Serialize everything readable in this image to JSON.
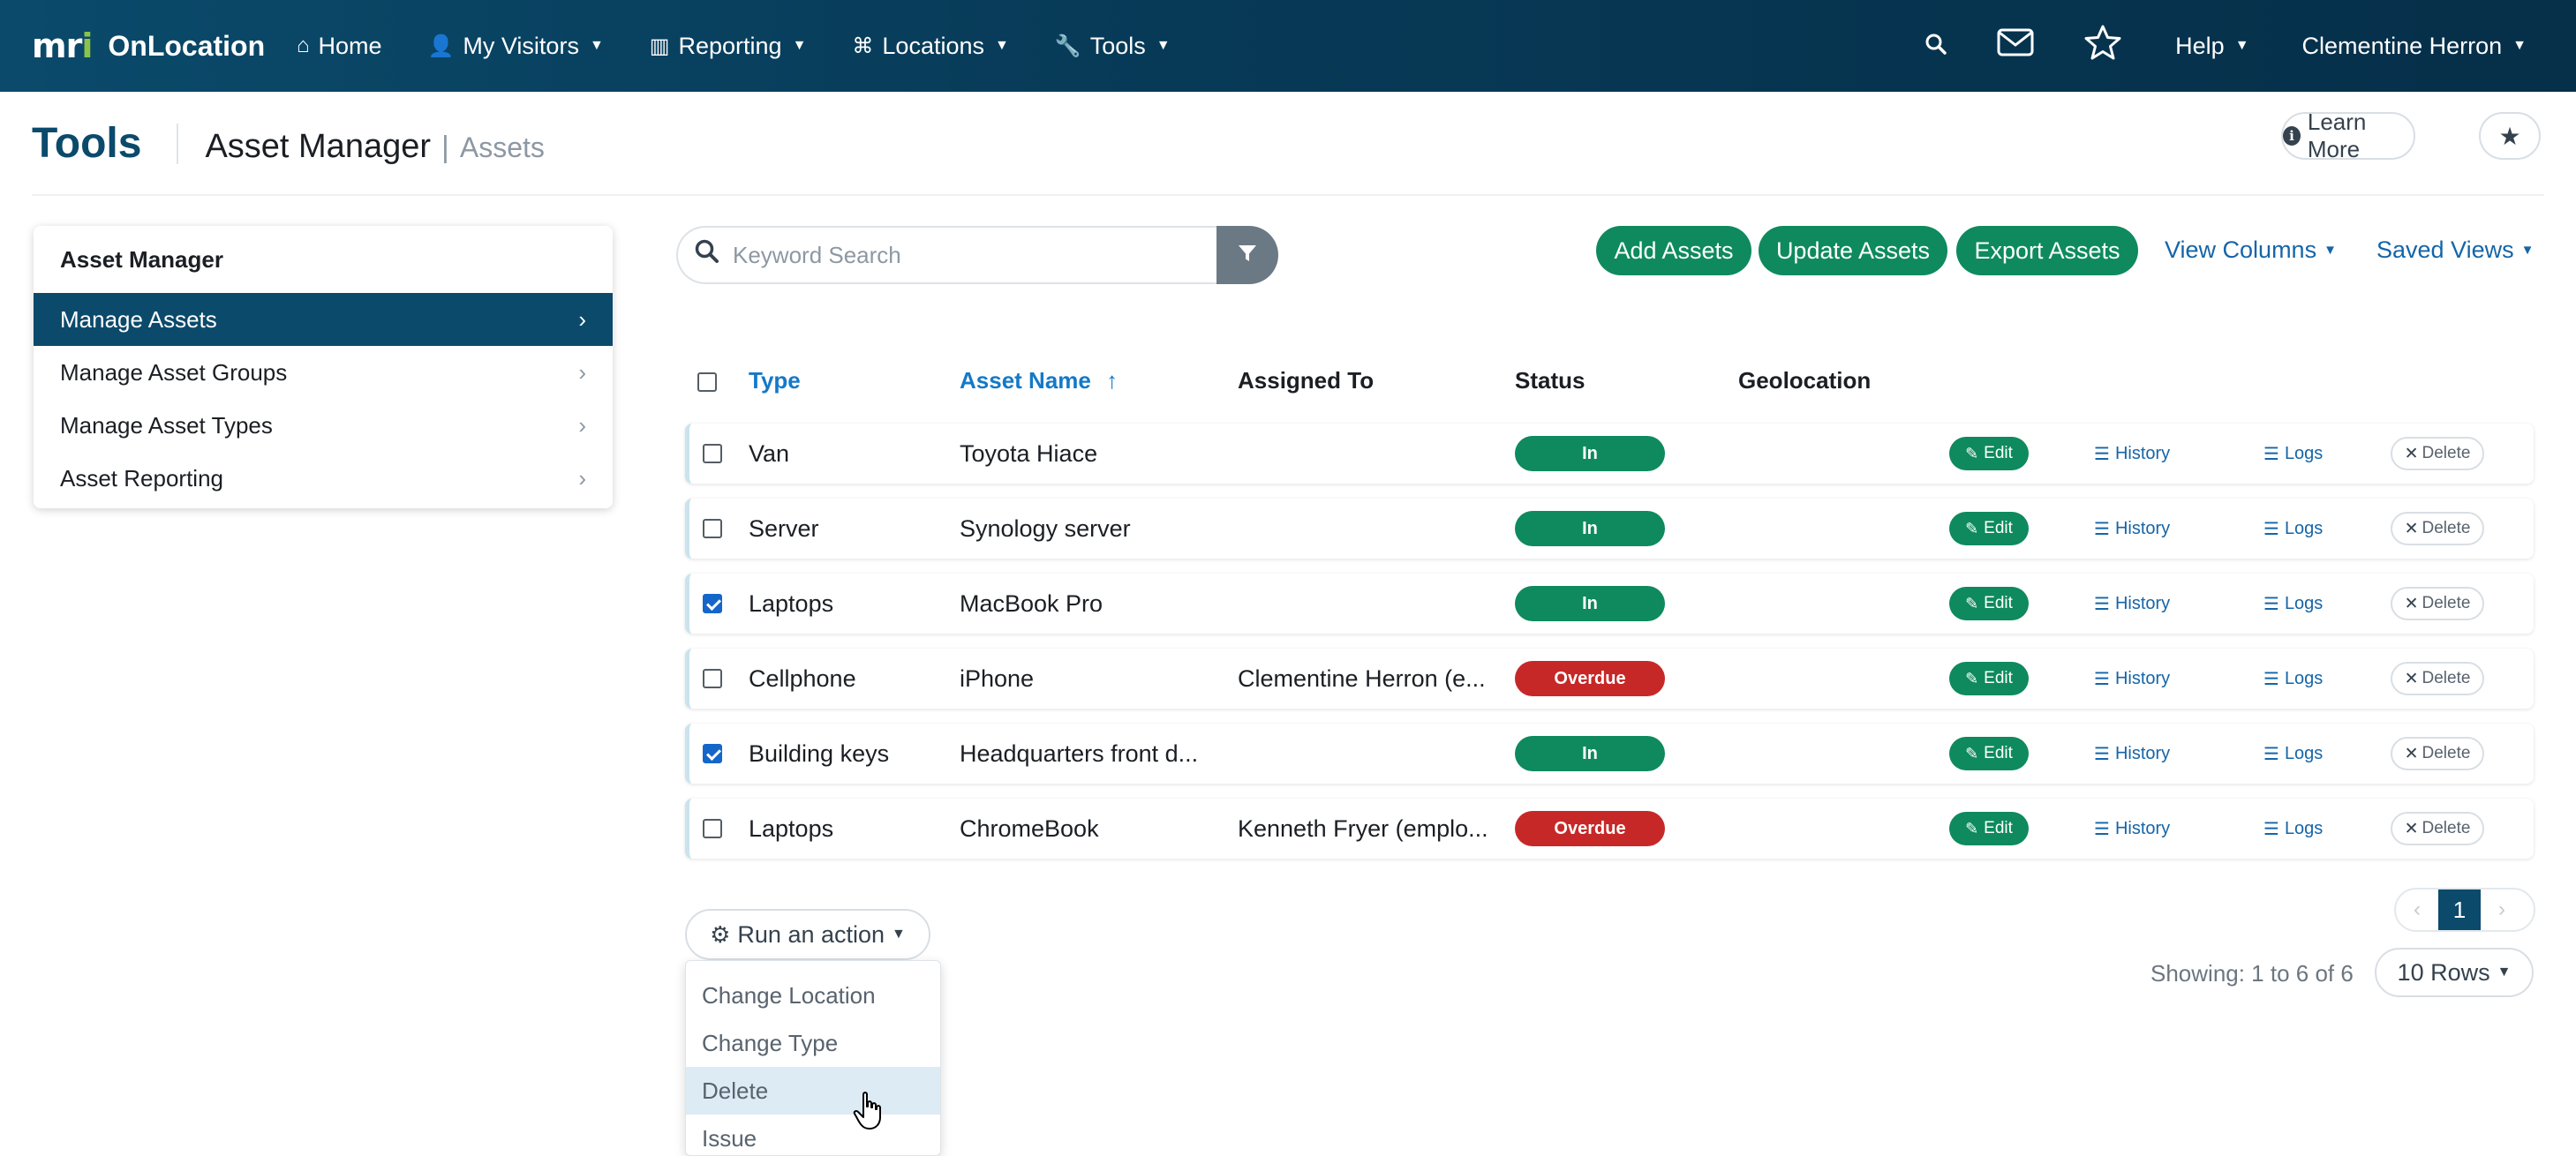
{
  "brand": {
    "logo": "mri",
    "name": "OnLocation"
  },
  "nav": {
    "home": "Home",
    "visitors": "My Visitors",
    "reporting": "Reporting",
    "locations": "Locations",
    "tools": "Tools",
    "help": "Help",
    "user": "Clementine Herron"
  },
  "header": {
    "title": "Tools",
    "subtitle": "Asset Manager",
    "separator": "|",
    "crumb": "Assets",
    "learn_more": "Learn More"
  },
  "sidebar": {
    "heading": "Asset Manager",
    "items": [
      {
        "label": "Manage Assets",
        "active": true
      },
      {
        "label": "Manage Asset Groups",
        "active": false
      },
      {
        "label": "Manage Asset Types",
        "active": false
      },
      {
        "label": "Asset Reporting",
        "active": false
      }
    ]
  },
  "search": {
    "placeholder": "Keyword Search",
    "value": ""
  },
  "toolbar": {
    "add": "Add Assets",
    "update": "Update Assets",
    "export": "Export Assets",
    "view_columns": "View Columns",
    "saved_views": "Saved Views"
  },
  "table": {
    "headers": {
      "type": "Type",
      "name": "Asset Name",
      "sort_arrow": "↑",
      "assigned": "Assigned To",
      "status": "Status",
      "geo": "Geolocation"
    },
    "actions": {
      "edit": "Edit",
      "history": "History",
      "logs": "Logs",
      "delete": "Delete"
    },
    "rows": [
      {
        "checked": false,
        "type": "Van",
        "name": "Toyota Hiace",
        "assigned": "",
        "status": "In"
      },
      {
        "checked": false,
        "type": "Server",
        "name": "Synology server",
        "assigned": "",
        "status": "In"
      },
      {
        "checked": true,
        "type": "Laptops",
        "name": "MacBook Pro",
        "assigned": "",
        "status": "In"
      },
      {
        "checked": false,
        "type": "Cellphone",
        "name": "iPhone",
        "assigned": "Clementine Herron (e...",
        "status": "Overdue"
      },
      {
        "checked": true,
        "type": "Building keys",
        "name": "Headquarters front d...",
        "assigned": "",
        "status": "In"
      },
      {
        "checked": false,
        "type": "Laptops",
        "name": "ChromeBook",
        "assigned": "Kenneth Fryer (emplo...",
        "status": "Overdue"
      }
    ]
  },
  "run_action": {
    "label": "Run an action",
    "options": [
      "Change Location",
      "Change Type",
      "Delete",
      "Issue"
    ],
    "hovered": "Delete"
  },
  "pagination": {
    "page": "1",
    "showing": "Showing: 1 to 6 of 6",
    "rows": "10 Rows"
  },
  "colors": {
    "navy": "#0b4a6b",
    "green": "#0e8a5e",
    "red": "#c62828",
    "link": "#1565a8"
  }
}
